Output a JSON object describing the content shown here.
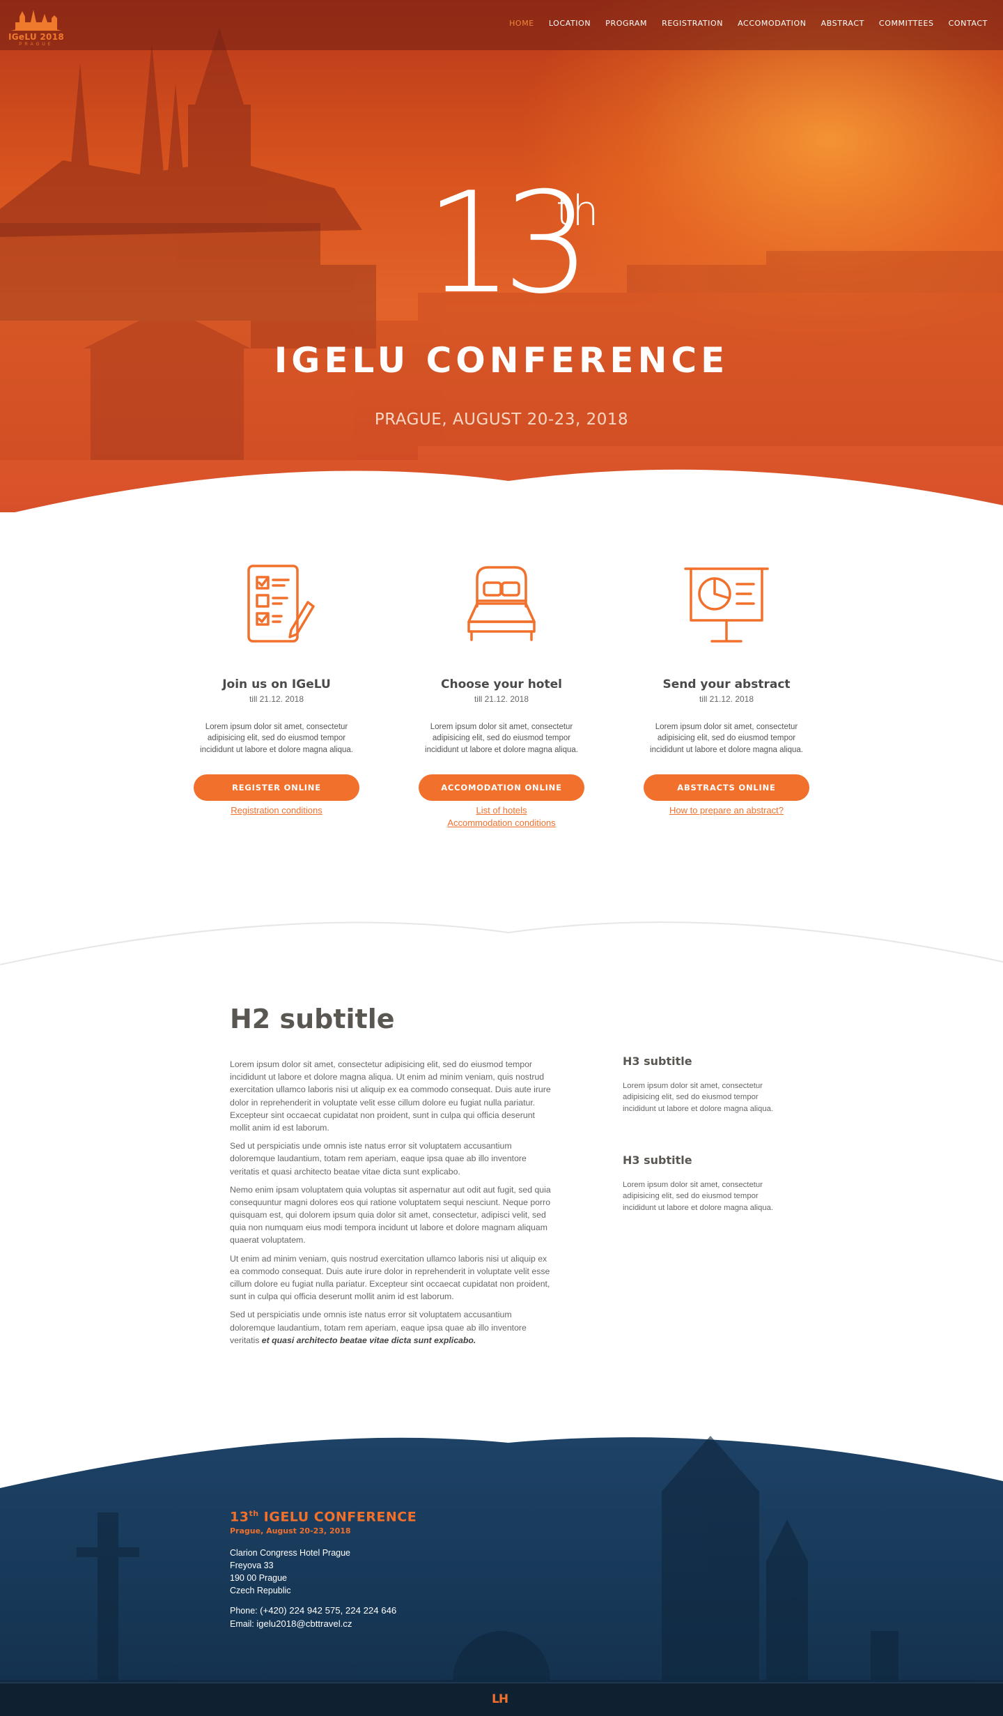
{
  "logo": {
    "name": "IGeLU 2018",
    "subtitle": "PRAGUE"
  },
  "nav": {
    "items": [
      {
        "label": "HOME",
        "active": true
      },
      {
        "label": "LOCATION"
      },
      {
        "label": "PROGRAM"
      },
      {
        "label": "REGISTRATION"
      },
      {
        "label": "ACCOMODATION"
      },
      {
        "label": "ABSTRACT"
      },
      {
        "label": "COMMITTEES"
      },
      {
        "label": "CONTACT"
      }
    ]
  },
  "hero": {
    "number": "13",
    "suffix": "th",
    "title": "IGELU CONFERENCE",
    "date": "PRAGUE, AUGUST 20-23, 2018"
  },
  "features": [
    {
      "icon": "checklist-icon",
      "title": "Join us on IGeLU",
      "date": "till 21.12. 2018",
      "text": "Lorem ipsum dolor sit amet, consectetur adipisicing elit, sed do eiusmod tempor incididunt ut labore et dolore magna aliqua.",
      "button": "REGISTER ONLINE",
      "links": [
        "Registration conditions"
      ]
    },
    {
      "icon": "bed-icon",
      "title": "Choose your hotel",
      "date": "till 21.12. 2018",
      "text": "Lorem ipsum dolor sit amet, consectetur adipisicing elit, sed do eiusmod tempor incididunt ut labore et dolore magna aliqua.",
      "button": "ACCOMODATION ONLINE",
      "links": [
        "List of hotels",
        "Accommodation conditions"
      ]
    },
    {
      "icon": "presentation-icon",
      "title": "Send your abstract",
      "date": "till 21.12. 2018",
      "text": "Lorem ipsum dolor sit amet, consectetur adipisicing elit, sed do eiusmod tempor incididunt ut labore et dolore magna aliqua.",
      "button": "ABSTRACTS ONLINE",
      "links": [
        "How to prepare an abstract?"
      ]
    }
  ],
  "content": {
    "h2": "H2 subtitle",
    "paragraphs": [
      "Lorem ipsum dolor sit amet, consectetur adipisicing elit, sed do eiusmod tempor incididunt ut labore et dolore magna aliqua. Ut enim ad minim veniam, quis nostrud exercitation ullamco laboris nisi ut aliquip ex ea commodo consequat. Duis aute irure dolor in reprehenderit in voluptate velit esse cillum dolore eu fugiat nulla pariatur. Excepteur sint occaecat cupidatat non proident, sunt in culpa qui officia deserunt mollit anim id est laborum.",
      "Sed ut perspiciatis unde omnis iste natus error sit voluptatem accusantium doloremque laudantium, totam rem aperiam, eaque ipsa quae ab illo inventore veritatis et quasi architecto beatae vitae dicta sunt explicabo.",
      "Nemo enim ipsam voluptatem quia voluptas sit aspernatur aut odit aut fugit, sed quia consequuntur magni dolores eos qui ratione voluptatem sequi nesciunt. Neque porro quisquam est, qui dolorem ipsum quia dolor sit amet, consectetur, adipisci velit, sed quia non numquam eius modi tempora incidunt ut labore et dolore magnam aliquam quaerat voluptatem.",
      "Ut enim ad minim veniam, quis nostrud exercitation ullamco laboris nisi ut aliquip ex ea commodo consequat. Duis aute irure dolor in reprehenderit in voluptate velit esse cillum dolore eu fugiat nulla pariatur. Excepteur sint occaecat cupidatat non proident, sunt in culpa qui officia deserunt mollit anim id est laborum."
    ],
    "last_paragraph": "Sed ut perspiciatis unde omnis iste natus error sit voluptatem accusantium doloremque laudantium, totam rem aperiam, eaque ipsa quae ab illo inventore veritatis",
    "last_paragraph_bold": "et quasi architecto beatae vitae dicta sunt explicabo.",
    "side": [
      {
        "title": "H3 subtitle",
        "text": "Lorem ipsum dolor sit amet, consectetur adipisicing elit, sed do eiusmod tempor incididunt ut labore et dolore magna aliqua."
      },
      {
        "title": "H3 subtitle",
        "text": "Lorem ipsum dolor sit amet, consectetur adipisicing elit, sed do eiusmod tempor incididunt ut labore et dolore magna aliqua."
      }
    ]
  },
  "footer": {
    "title_num": "13",
    "title_sup": "th",
    "title_text": " IGELU CONFERENCE",
    "date": "Prague, August 20-23, 2018",
    "address": [
      "Clarion Congress Hotel Prague",
      "Freyova 33",
      "190 00 Prague",
      "Czech Republic"
    ],
    "phone_label": "Phone:",
    "phone": "(+420) 224 942 575, 224 224 646",
    "email_label": "Email:",
    "email": "igelu2018@cbttravel.cz",
    "bottom_logo": "LH"
  },
  "colors": {
    "accent": "#f0702c",
    "hero_orange": "#e2632a",
    "footer_navy": "#1a3a58",
    "heading": "#5a5651"
  }
}
